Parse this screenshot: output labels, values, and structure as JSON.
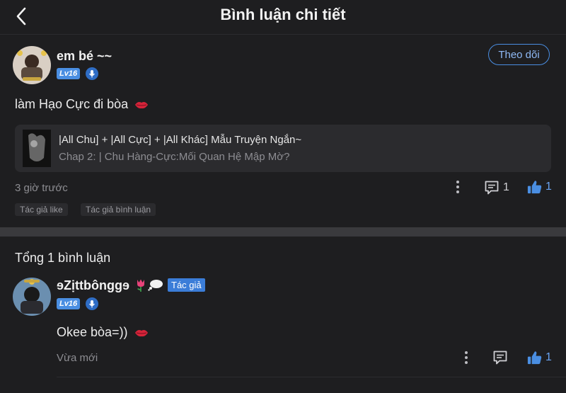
{
  "header": {
    "title": "Bình luận chi tiết"
  },
  "post": {
    "username": "em bé ~~",
    "level": "Lv16",
    "follow_label": "Theo dõi",
    "text": "làm Hạo Cực đi bòa",
    "story": {
      "title": "|All Chu] + |All Cực] + |All Khác] Mẫu Truyện Ngắn~",
      "chapter": "Chap 2: | Chu Hàng-Cực:Mối Quan Hệ Mập Mờ?"
    },
    "time": "3 giờ trước",
    "reply_count": "1",
    "like_count": "1",
    "tags": [
      "Tác giả like",
      "Tác giả bình luận"
    ]
  },
  "comments": {
    "total_label": "Tổng 1 bình luận",
    "items": [
      {
        "username": "ɘZịttbônggɘ",
        "level": "Lv16",
        "author_badge": "Tác giả",
        "text": "Okee bòa=))",
        "time": "Vừa mới",
        "like_count": "1"
      }
    ]
  },
  "colors": {
    "background": "#1e1e20",
    "accent": "#4a8ee2",
    "secondary_text": "#8d8d92",
    "card": "#2b2b2e"
  },
  "icons": [
    "back-arrow-icon",
    "mic-icon",
    "kiss-lips-icon",
    "more-dots-icon",
    "comment-icon",
    "thumbs-up-icon",
    "tulip-icon",
    "thought-bubble-icon"
  ]
}
